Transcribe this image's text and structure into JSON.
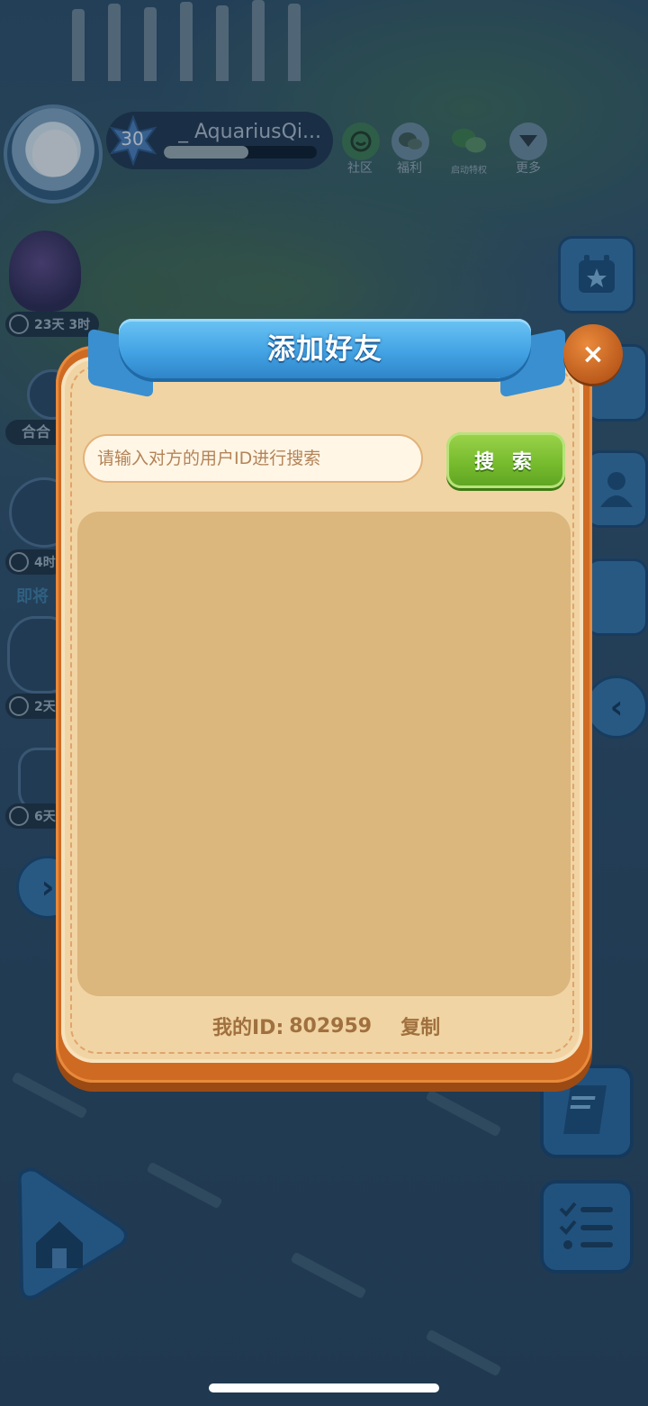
{
  "hud": {
    "level": "30",
    "player_name": "_ AquariusQi...",
    "xp_progress": 0.55,
    "icons": [
      {
        "name": "community-icon",
        "label": "社区"
      },
      {
        "name": "welfare-icon",
        "label": "福利"
      },
      {
        "name": "wechat-icon",
        "label": "启动特权"
      },
      {
        "name": "more-icon",
        "label": "更多"
      }
    ]
  },
  "side_events": {
    "timer1": "23天 3时",
    "chip": "合合",
    "timer2": "4时",
    "soon": "即将",
    "timer3": "2天",
    "timer4": "6天"
  },
  "dialog": {
    "title": "添加好友",
    "close_glyph": "×",
    "search_placeholder": "请输入对方的用户ID进行搜索",
    "search_button": "搜 索",
    "my_id_label": "我的ID:",
    "my_id_value": "802959",
    "copy_label": "复制"
  },
  "colors": {
    "dialog_frame": "#cf6a22",
    "dialog_fill": "#f1d4a3",
    "ribbon": "#43a3e4",
    "search_button": "#74b92c",
    "results_panel": "#dbb67d"
  }
}
